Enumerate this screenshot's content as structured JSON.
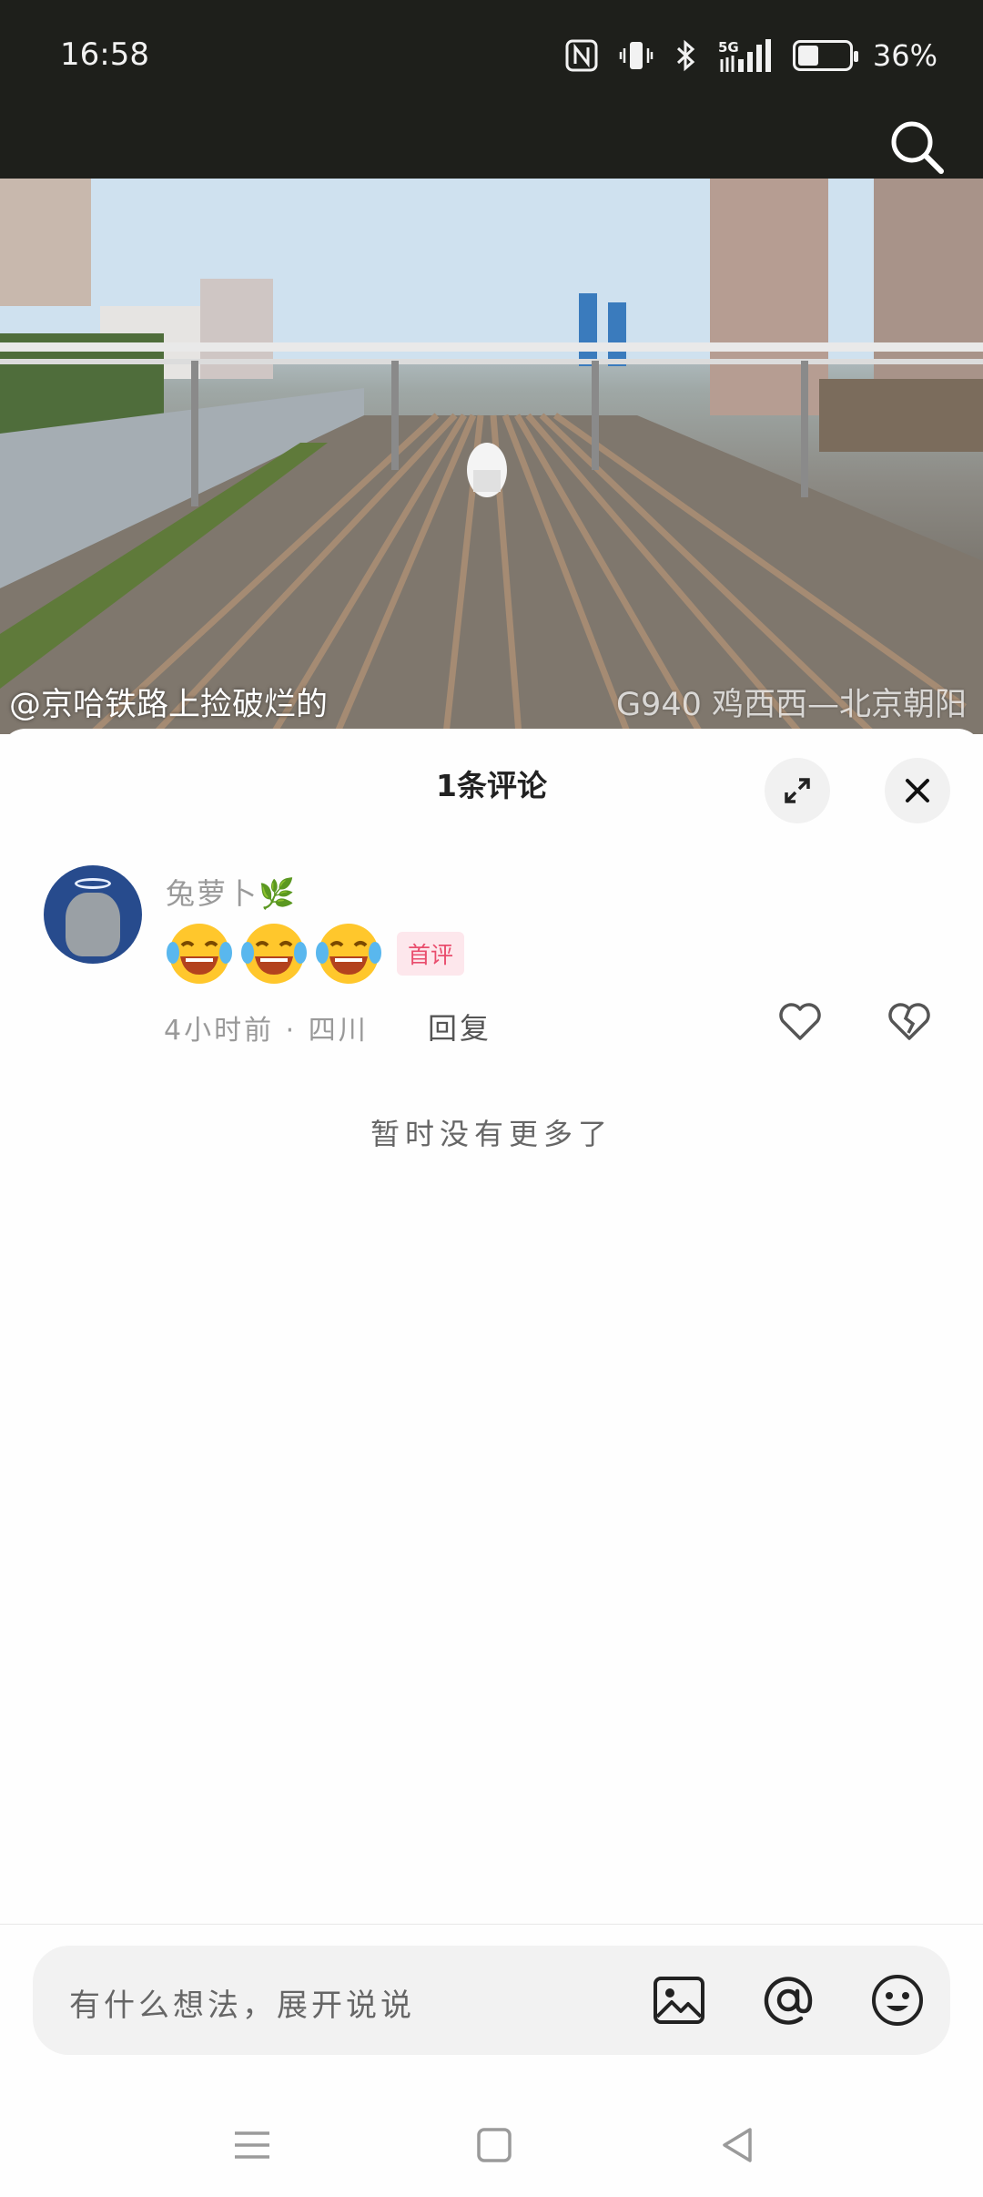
{
  "status_bar": {
    "time": "16:58",
    "network": "5G",
    "battery": "36%",
    "battery_level": 0.36,
    "icons": [
      "nfc-icon",
      "vibrate-icon",
      "bluetooth-icon",
      "signal-5g-icon",
      "battery-icon"
    ]
  },
  "video": {
    "overlay_left": "@京哈铁路上捡破烂的",
    "overlay_right": "G940 鸡西西—北京朝阳"
  },
  "comments_sheet": {
    "title": "1条评论",
    "comments": [
      {
        "username": "兔萝卜🌿",
        "content_emojis": [
          "😂",
          "😂",
          "😂"
        ],
        "badge": "首评",
        "meta": "4小时前 · 四川",
        "reply_label": "回复"
      }
    ],
    "no_more_text": "暂时没有更多了"
  },
  "input": {
    "placeholder": "有什么想法，展开说说",
    "icons": [
      "image-icon",
      "at-icon",
      "emoji-icon"
    ]
  },
  "nav_bar": {
    "icons": [
      "menu-icon",
      "home-icon",
      "back-icon"
    ]
  },
  "colors": {
    "status_bar_bg": "#1e1f1b",
    "badge_bg": "#fde7ec",
    "badge_text": "#e94d6d",
    "sheet_bg": "#fefefe"
  }
}
